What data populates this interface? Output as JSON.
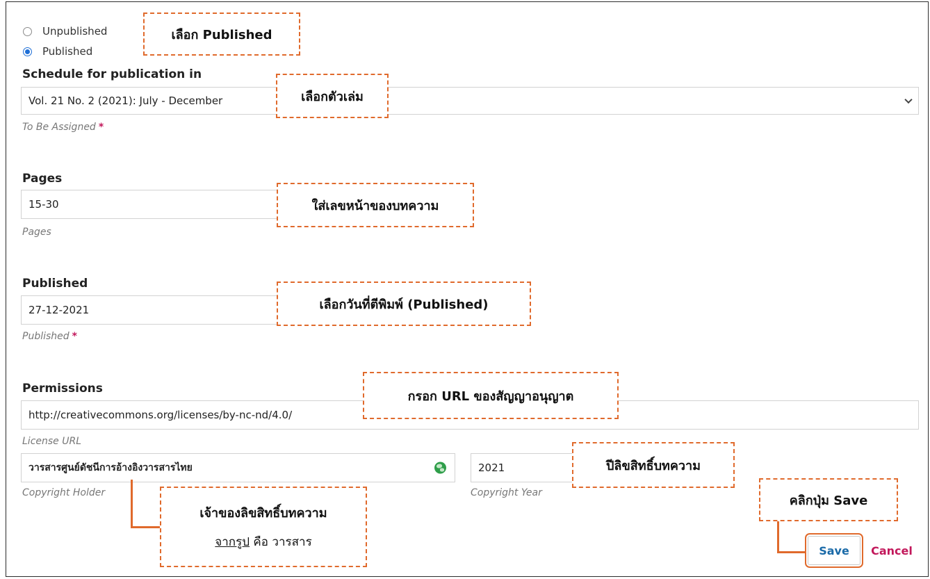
{
  "status": {
    "unpublished_label": "Unpublished",
    "published_label": "Published",
    "selected": "Published"
  },
  "schedule": {
    "label": "Schedule for publication in",
    "value": "Vol. 21 No. 2 (2021): July - December",
    "hint": "To Be Assigned",
    "required_mark": "*"
  },
  "pages": {
    "label": "Pages",
    "value": "15-30",
    "hint": "Pages"
  },
  "published_date": {
    "label": "Published",
    "value": "27-12-2021",
    "hint": "Published",
    "required_mark": "*"
  },
  "permissions": {
    "label": "Permissions",
    "license_url": "http://creativecommons.org/licenses/by-nc-nd/4.0/",
    "license_hint": "License URL",
    "copyright_holder": "วารสารศูนย์ดัชนีการอ้างอิงวารสารไทย",
    "copyright_holder_hint": "Copyright Holder",
    "copyright_year": "2021",
    "copyright_year_hint": "Copyright Year"
  },
  "buttons": {
    "save": "Save",
    "cancel": "Cancel"
  },
  "annotations": {
    "select_published": "เลือก Published",
    "select_issue": "เลือกตัวเล่ม",
    "enter_pages": "ใส่เลขหน้าของบทความ",
    "select_date": "เลือกวันที่ตีพิมพ์ (Published)",
    "enter_license": "กรอก URL ของสัญญาอนุญาต",
    "copyright_year": "ปีลิขสิทธิ์บทความ",
    "copyright_owner": "เจ้าของลิขสิทธิ์บทความ",
    "copyright_owner_example_link": "จากรูป",
    "copyright_owner_example_rest": " คือ วารสาร",
    "click_save": "คลิกปุ่ม Save"
  },
  "colors": {
    "annotation_border": "#e06a2c",
    "save_text": "#1a6aa8",
    "cancel_text": "#c2185b",
    "radio_selected": "#1f6fd6"
  },
  "icons": {
    "copyright_holder_locale": "globe-icon",
    "schedule_dropdown": "chevron-down-icon"
  }
}
